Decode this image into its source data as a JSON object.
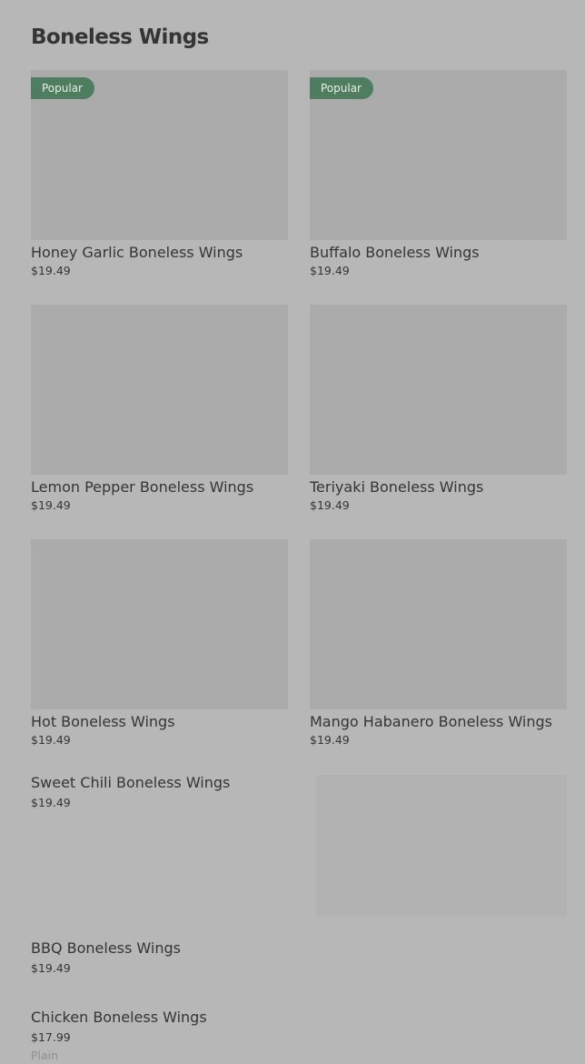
{
  "section": {
    "title": "Boneless Wings"
  },
  "colors": {
    "page_background": "#b7b7b7",
    "badge_background": "#4f7d5f",
    "image_placeholder": "#ababab"
  },
  "grid_items": [
    {
      "name": "Honey Garlic Boneless Wings",
      "price": "$19.49",
      "badge": "Popular"
    },
    {
      "name": "Buffalo Boneless Wings",
      "price": "$19.49",
      "badge": "Popular"
    },
    {
      "name": "Lemon Pepper Boneless Wings",
      "price": "$19.49",
      "badge": ""
    },
    {
      "name": "Teriyaki Boneless Wings",
      "price": "$19.49",
      "badge": ""
    },
    {
      "name": "Hot Boneless Wings",
      "price": "$19.49",
      "badge": ""
    },
    {
      "name": "Mango Habanero  Boneless Wings",
      "price": "$19.49",
      "badge": ""
    }
  ],
  "list_items": [
    {
      "name": "Sweet Chili Boneless Wings",
      "price": "$19.49"
    },
    {
      "name": "BBQ Boneless Wings",
      "price": "$19.49"
    },
    {
      "name": "Chicken Boneless Wings",
      "price": "$17.99",
      "variant": "Plain"
    }
  ]
}
